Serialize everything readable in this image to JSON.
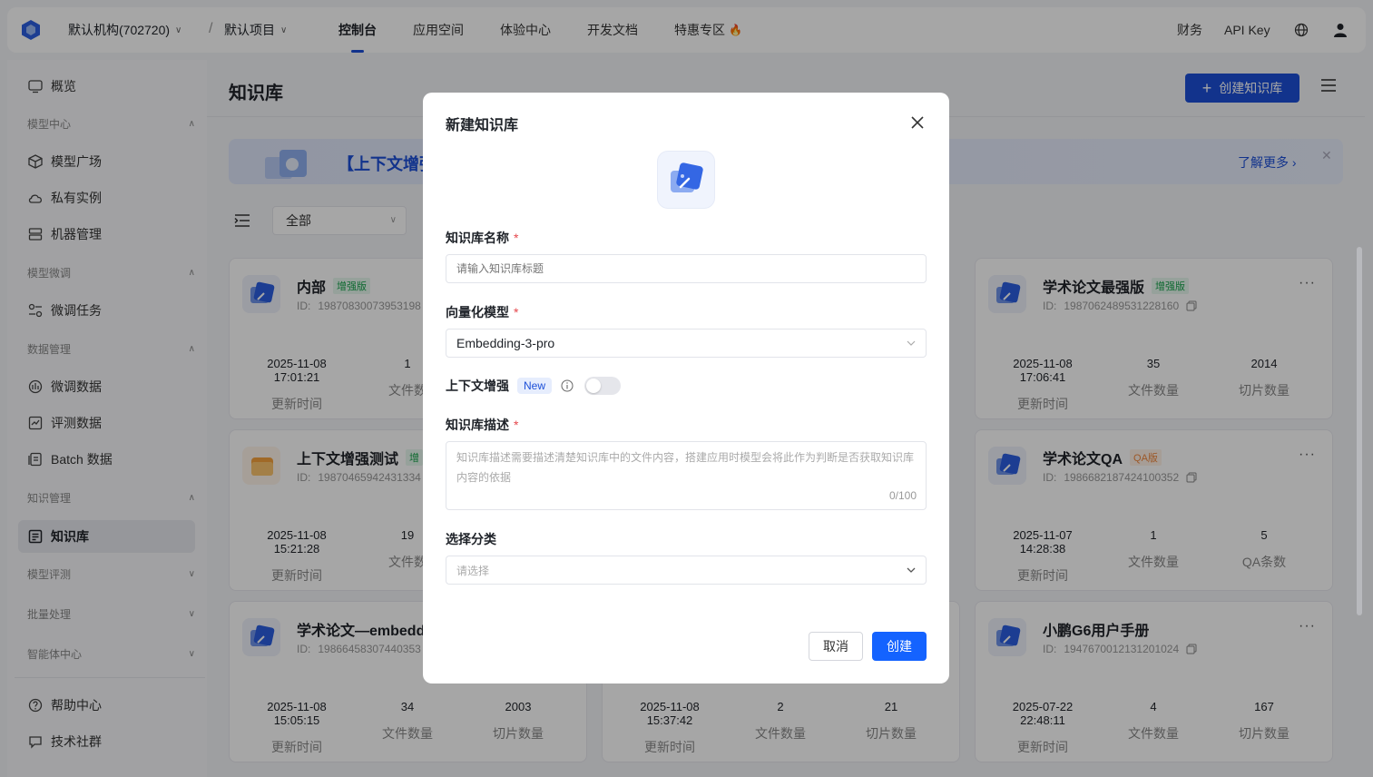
{
  "topbar": {
    "org": "默认机构(702720)",
    "project": "默认项目",
    "separator": "/",
    "tabs": [
      {
        "label": "控制台",
        "active": true
      },
      {
        "label": "应用空间"
      },
      {
        "label": "体验中心"
      },
      {
        "label": "开发文档"
      },
      {
        "label": "特惠专区"
      }
    ],
    "hot_icon": "🔥",
    "finance": "财务",
    "api_key": "API Key"
  },
  "sidebar": {
    "overview": "概览",
    "group_model_center": "模型中心",
    "model_square": "模型广场",
    "private_instance": "私有实例",
    "machine_mgmt": "机器管理",
    "group_finetune": "模型微调",
    "finetune_task": "微调任务",
    "group_data_mgmt": "数据管理",
    "finetune_data": "微调数据",
    "eval_data": "评测数据",
    "batch_data": "Batch 数据",
    "group_knowledge": "知识管理",
    "knowledge_base": "知识库",
    "group_eval": "模型评测",
    "group_batch": "批量处理",
    "group_agent": "智能体中心",
    "help_center": "帮助中心",
    "tech_community": "技术社群"
  },
  "main": {
    "page_title": "知识库",
    "create_button": "创建知识库",
    "create_plus": "+",
    "banner_title": "【上下文增强",
    "banner_more": "了解更多 ›",
    "banner_close": "✕",
    "filter_value": "全部"
  },
  "cards": [
    {
      "title": "内部",
      "tag": "增强版",
      "id_label": "ID:",
      "id": "19870830073953198",
      "time": "2025-11-08 17:01:21",
      "time_label": "更新时间",
      "files": "1",
      "files_label": "文件数"
    },
    {
      "title": "学术论文最强版",
      "tag": "增强版",
      "id_label": "ID:",
      "id": "1987062489531228160",
      "time": "2025-11-08 17:06:41",
      "time_label": "更新时间",
      "files": "35",
      "files_label": "文件数量",
      "chunks": "2014",
      "chunks_label": "切片数量"
    },
    {
      "title": "上下文增强测试",
      "tag": "增",
      "id_label": "ID:",
      "id": "19870465942431334",
      "time": "2025-11-08 15:21:28",
      "time_label": "更新时间",
      "files": "19",
      "files_label": "文件数"
    },
    {
      "title": "学术论文QA",
      "tag": "QA版",
      "id_label": "ID:",
      "id": "1986682187424100352",
      "time": "2025-11-07 14:28:38",
      "time_label": "更新时间",
      "files": "1",
      "files_label": "文件数量",
      "chunks": "5",
      "chunks_label": "QA条数"
    },
    {
      "title": "学术论文—embedd",
      "id_label": "ID:",
      "id": "19866458307440353",
      "time": "2025-11-08 15:05:15",
      "time_label": "更新时间",
      "files": "34",
      "files_label": "文件数量",
      "chunks": "2003",
      "chunks_label": "切片数量"
    },
    {
      "time": "2025-11-08 15:37:42",
      "time_label": "更新时间",
      "files": "2",
      "files_label": "文件数量",
      "chunks": "21",
      "chunks_label": "切片数量"
    },
    {
      "title": "小鹏G6用户手册",
      "id_label": "ID:",
      "id": "1947670012131201024",
      "time": "2025-07-22 22:48:11",
      "time_label": "更新时间",
      "files": "4",
      "files_label": "文件数量",
      "chunks": "167",
      "chunks_label": "切片数量"
    }
  ],
  "more_dots": "···",
  "modal": {
    "title": "新建知识库",
    "name_label": "知识库名称",
    "required_mark": "*",
    "name_placeholder": "请输入知识库标题",
    "vector_label": "向量化模型",
    "vector_value": "Embedding-3-pro",
    "context_label": "上下文增强",
    "new_badge": "New",
    "context_enabled": false,
    "desc_label": "知识库描述",
    "desc_placeholder": "知识库描述需要描述清楚知识库中的文件内容，搭建应用时模型会将此作为判断是否获取知识库内容的依据",
    "desc_counter": "0/100",
    "category_label": "选择分类",
    "category_placeholder": "请选择",
    "cancel": "取消",
    "create": "创建"
  },
  "colors": {
    "primary": "#1c4fd8",
    "primary_button": "#1463ff",
    "required": "#e5484d",
    "green_tag": "#16a34a",
    "orange_tag": "#f0883e"
  }
}
